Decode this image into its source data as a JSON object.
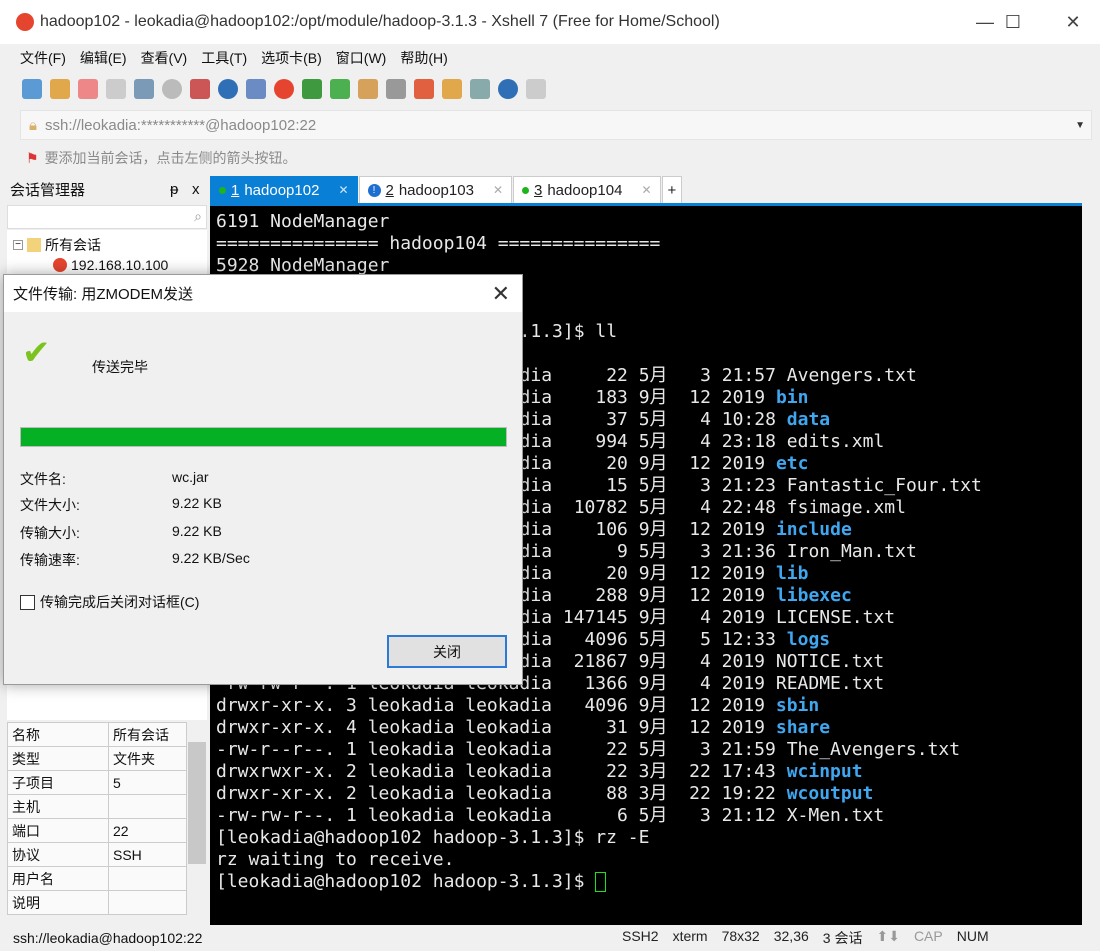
{
  "window": {
    "title": "hadoop102 - leokadia@hadoop102:/opt/module/hadoop-3.1.3 - Xshell 7 (Free for Home/School)",
    "minimize": "—",
    "maximize": "☐",
    "close": "✕"
  },
  "menu": [
    "文件(F)",
    "编辑(E)",
    "查看(V)",
    "工具(T)",
    "选项卡(B)",
    "窗口(W)",
    "帮助(H)"
  ],
  "address": {
    "value": "ssh://leokadia:***********@hadoop102:22"
  },
  "hint": "要添加当前会话，点击左侧的箭头按钮。",
  "session_manager": {
    "title": "会话管理器",
    "pin": "ᵽ",
    "close": "x",
    "tree": [
      {
        "label": "所有会话"
      },
      {
        "label": "192.168.10.100"
      }
    ],
    "properties": [
      [
        "名称",
        "所有会话"
      ],
      [
        "类型",
        "文件夹"
      ],
      [
        "子项目",
        "5"
      ],
      [
        "主机",
        ""
      ],
      [
        "端口",
        "22"
      ],
      [
        "协议",
        "SSH"
      ],
      [
        "用户名",
        ""
      ],
      [
        "说明",
        ""
      ]
    ]
  },
  "tabs": [
    {
      "num": "1",
      "label": "hadoop102",
      "status": "connected"
    },
    {
      "num": "2",
      "label": "hadoop103",
      "status": "alert"
    },
    {
      "num": "3",
      "label": "hadoop104",
      "status": "connected"
    }
  ],
  "new_tab": "+",
  "terminal": {
    "lines": [
      {
        "row": 0,
        "text": "6191 NodeManager"
      },
      {
        "row": 1,
        "text": "=============== hadoop104 ==============="
      },
      {
        "row": 2,
        "text": "5928 NodeManager"
      },
      {
        "row": 5,
        "text": ".1.3]$ ll",
        "col": 28
      },
      {
        "row": 7,
        "text": "dia     22 5月   3 21:57 ",
        "name": "Avengers.txt",
        "col": 28
      },
      {
        "row": 8,
        "text": "dia    183 9月  12 2019 ",
        "name": "bin",
        "dir": true,
        "col": 28
      },
      {
        "row": 9,
        "text": "dia     37 5月   4 10:28 ",
        "name": "data",
        "dir": true,
        "col": 28
      },
      {
        "row": 10,
        "text": "dia    994 5月   4 23:18 ",
        "name": "edits.xml",
        "col": 28
      },
      {
        "row": 11,
        "text": "dia     20 9月  12 2019 ",
        "name": "etc",
        "dir": true,
        "col": 28
      },
      {
        "row": 12,
        "text": "dia     15 5月   3 21:23 ",
        "name": "Fantastic_Four.txt",
        "col": 28
      },
      {
        "row": 13,
        "text": "dia  10782 5月   4 22:48 ",
        "name": "fsimage.xml",
        "col": 28
      },
      {
        "row": 14,
        "text": "dia    106 9月  12 2019 ",
        "name": "include",
        "dir": true,
        "col": 28
      },
      {
        "row": 15,
        "text": "dia      9 5月   3 21:36 ",
        "name": "Iron_Man.txt",
        "col": 28
      },
      {
        "row": 16,
        "text": "dia     20 9月  12 2019 ",
        "name": "lib",
        "dir": true,
        "col": 28
      },
      {
        "row": 17,
        "text": "dia    288 9月  12 2019 ",
        "name": "libexec",
        "dir": true,
        "col": 28
      },
      {
        "row": 18,
        "text": "dia 147145 9月   4 2019 ",
        "name": "LICENSE.txt",
        "col": 28
      },
      {
        "row": 19,
        "text": "dia   4096 5月   5 12:33 ",
        "name": "logs",
        "dir": true,
        "col": 28
      },
      {
        "row": 20,
        "text": "-rw-rw-r--. 1 leokadia leokadia  21867 9月   4 2019 ",
        "name": "NOTICE.txt"
      },
      {
        "row": 21,
        "text": "-rw-rw-r--. 1 leokadia leokadia   1366 9月   4 2019 ",
        "name": "README.txt"
      },
      {
        "row": 22,
        "text": "drwxr-xr-x. 3 leokadia leokadia   4096 9月  12 2019 ",
        "name": "sbin",
        "dir": true
      },
      {
        "row": 23,
        "text": "drwxr-xr-x. 4 leokadia leokadia     31 9月  12 2019 ",
        "name": "share",
        "dir": true
      },
      {
        "row": 24,
        "text": "-rw-r--r--. 1 leokadia leokadia     22 5月   3 21:59 ",
        "name": "The_Avengers.txt"
      },
      {
        "row": 25,
        "text": "drwxrwxr-x. 2 leokadia leokadia     22 3月  22 17:43 ",
        "name": "wcinput",
        "dir": true
      },
      {
        "row": 26,
        "text": "drwxr-xr-x. 2 leokadia leokadia     88 3月  22 19:22 ",
        "name": "wcoutput",
        "dir": true
      },
      {
        "row": 27,
        "text": "-rw-rw-r--. 1 leokadia leokadia      6 5月   3 21:12 ",
        "name": "X-Men.txt"
      },
      {
        "row": 28,
        "text": "[leokadia@hadoop102 hadoop-3.1.3]$ rz -E"
      },
      {
        "row": 29,
        "text": "rz waiting to receive."
      },
      {
        "row": 30,
        "text": "[leokadia@hadoop102 hadoop-3.1.3]$ ",
        "cursor": true
      }
    ],
    "dir_color": "#3fa6f0"
  },
  "dialog": {
    "title": "文件传输: 用ZMODEM发送",
    "status": "传送完毕",
    "progress_percent": 100,
    "progress_color": "#06b025",
    "fields": [
      {
        "label": "文件名:",
        "value": "wc.jar"
      },
      {
        "label": "文件大小:",
        "value": "9.22 KB"
      },
      {
        "label": "传输大小:",
        "value": "9.22 KB"
      },
      {
        "label": "传输速率:",
        "value": "9.22 KB/Sec"
      }
    ],
    "checkbox_label": "传输完成后关闭对话框(C)",
    "checkbox_checked": false,
    "close_button": "关闭"
  },
  "statusbar": {
    "left": "ssh://leokadia@hadoop102:22",
    "protocol": "SSH2",
    "term": "xterm",
    "size": "78x32",
    "cursor": "32,36",
    "sessions": "3 会话",
    "cap": "CAP",
    "num": "NUM"
  }
}
